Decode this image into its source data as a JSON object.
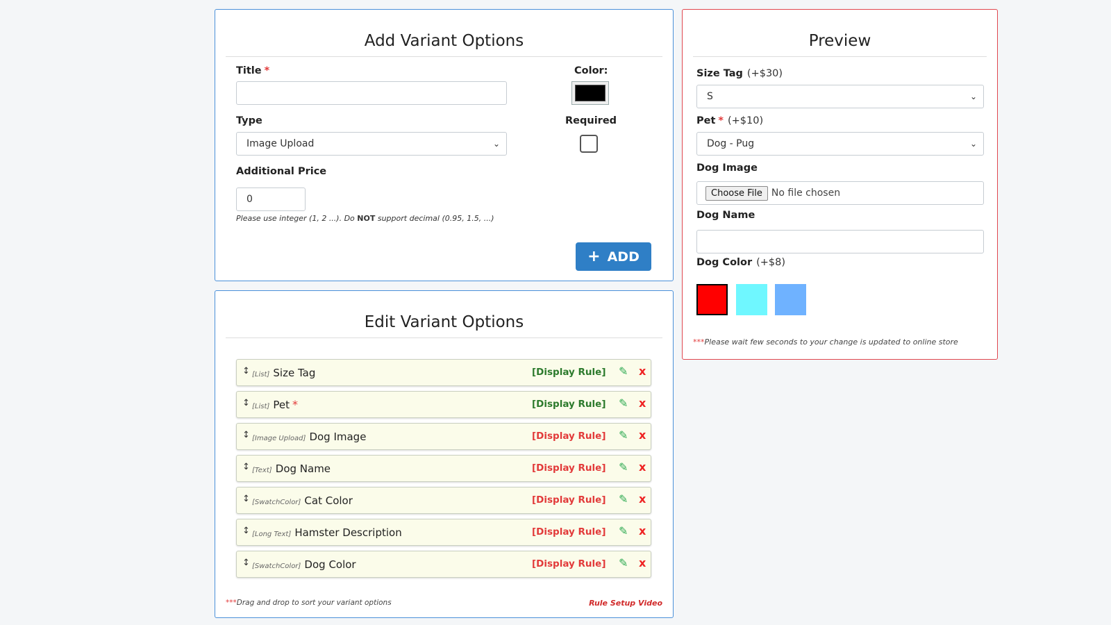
{
  "add_panel": {
    "title": "Add Variant Options",
    "title_label": "Title",
    "required_mark": "*",
    "title_value": "",
    "color_label": "Color:",
    "color_value": "#000000",
    "type_label": "Type",
    "type_selected": "Image Upload",
    "required_label": "Required",
    "required_checked": false,
    "price_label": "Additional Price",
    "price_value": "0",
    "hint_pre": "Please use integer (1, 2 ...). Do ",
    "hint_bold": "NOT",
    "hint_post": " support decimal (0.95, 1.5, ...)",
    "add_icon": "+",
    "add_label": "ADD"
  },
  "edit_panel": {
    "title": "Edit Variant Options",
    "drag_icon": "↕",
    "edit_icon": "✎",
    "delete_icon": "x",
    "options": [
      {
        "type": "[List]",
        "name": "Size Tag",
        "required": false,
        "rule": "[Display Rule]",
        "rule_color": "#2c7a2c"
      },
      {
        "type": "[List]",
        "name": "Pet",
        "required": true,
        "rule": "[Display Rule]",
        "rule_color": "#2c7a2c"
      },
      {
        "type": "[Image Upload]",
        "name": "Dog Image",
        "required": false,
        "rule": "[Display Rule]",
        "rule_color": "#e23a3a"
      },
      {
        "type": "[Text]",
        "name": "Dog Name",
        "required": false,
        "rule": "[Display Rule]",
        "rule_color": "#e23a3a"
      },
      {
        "type": "[SwatchColor]",
        "name": "Cat Color",
        "required": false,
        "rule": "[Display Rule]",
        "rule_color": "#e23a3a"
      },
      {
        "type": "[Long Text]",
        "name": "Hamster Description",
        "required": false,
        "rule": "[Display Rule]",
        "rule_color": "#e23a3a"
      },
      {
        "type": "[SwatchColor]",
        "name": "Dog Color",
        "required": false,
        "rule": "[Display Rule]",
        "rule_color": "#e23a3a"
      }
    ],
    "footer_stars": "***",
    "footer_note": "Drag and drop to sort your variant options",
    "rule_video": "Rule Setup Video"
  },
  "preview_panel": {
    "title": "Preview",
    "size_tag_label": "Size Tag",
    "size_tag_addon": "(+$30)",
    "size_tag_value": "S",
    "pet_label": "Pet",
    "pet_required": "*",
    "pet_addon": "(+$10)",
    "pet_value": "Dog - Pug",
    "dog_image_label": "Dog Image",
    "choose_file": "Choose File",
    "no_file": "No file chosen",
    "dog_name_label": "Dog Name",
    "dog_name_value": "",
    "dog_color_label": "Dog Color",
    "dog_color_addon": "(+$8)",
    "swatches": [
      "#ff0000",
      "#6ff7ff",
      "#6fb2ff"
    ],
    "note_stars": "***",
    "note": "Please wait few seconds to your change is updated to online store"
  },
  "icons": {
    "select_chevron": "⌄"
  }
}
